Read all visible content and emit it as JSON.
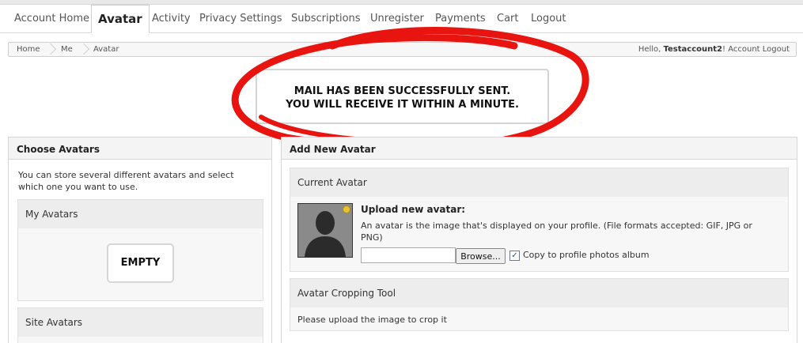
{
  "nav": {
    "tabs": [
      {
        "label": "Account Home"
      },
      {
        "label": "Avatar"
      },
      {
        "label": "Activity"
      },
      {
        "label": "Privacy Settings"
      },
      {
        "label": "Subscriptions"
      },
      {
        "label": "Unregister"
      },
      {
        "label": "Payments"
      },
      {
        "label": "Cart"
      },
      {
        "label": "Logout"
      }
    ]
  },
  "breadcrumb": {
    "items": [
      "Home",
      "Me",
      "Avatar"
    ],
    "hello_prefix": "Hello,",
    "username": "Testaccount2",
    "hello_suffix": "!",
    "logout_label": "Account Logout"
  },
  "message": {
    "line1": "MAIL HAS BEEN SUCCESSFULLY SENT.",
    "line2": "YOU WILL RECEIVE IT WITHIN A MINUTE.",
    "highlight_color": "#e8140f"
  },
  "choose_avatars": {
    "title": "Choose Avatars",
    "description": "You can store several different avatars and select which one you want to use.",
    "my_avatars_label": "My Avatars",
    "empty_label": "EMPTY",
    "site_avatars_label": "Site Avatars"
  },
  "add_new_avatar": {
    "title": "Add New Avatar",
    "current_avatar_label": "Current Avatar",
    "upload_title": "Upload new avatar:",
    "upload_desc": "An avatar is the image that's displayed on your profile. (File formats accepted: GIF, JPG or PNG)",
    "file_value": "",
    "browse_label": "Browse...",
    "copy_label": "Copy to profile photos album",
    "copy_checked": true,
    "cropping_label": "Avatar Cropping Tool",
    "cropping_text": "Please upload the image to crop it"
  }
}
